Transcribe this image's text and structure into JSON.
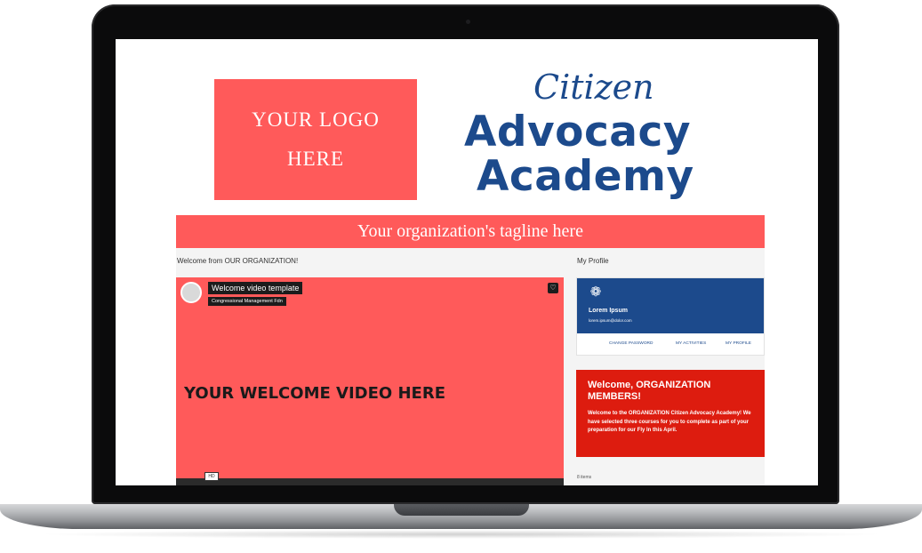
{
  "header": {
    "logo_line1": "YOUR LOGO",
    "logo_line2": "HERE",
    "brand_script": "Citizen",
    "brand_line1": "Advocacy",
    "brand_line2": "Academy"
  },
  "tagline": "Your organization's tagline here",
  "main": {
    "section_label": "Welcome from OUR ORGANIZATION!",
    "video": {
      "title": "Welcome video template",
      "subtitle": "Congressional Management Fdn",
      "placeholder": "YOUR WELCOME VIDEO HERE",
      "badge": "HD"
    }
  },
  "sidebar": {
    "section_label": "My Profile",
    "profile": {
      "name": "Lorem Ipsum",
      "email": "lorem.ipsum@dolor.com",
      "links": [
        "CHANGE PASSWORD",
        "MY ACTIVITIES",
        "MY PROFILE"
      ]
    },
    "welcome": {
      "title": "Welcome, ORGANIZATION MEMBERS!",
      "body": "Welcome to the ORGANIZATION Citizen Advocacy Academy! We have selected three courses for you to complete as part of your preparation for our Fly In this April."
    },
    "items_count": "8 items"
  },
  "colors": {
    "accent": "#ff5a5a",
    "brand_blue": "#1c4a8c",
    "alert_red": "#dd1c0f"
  }
}
